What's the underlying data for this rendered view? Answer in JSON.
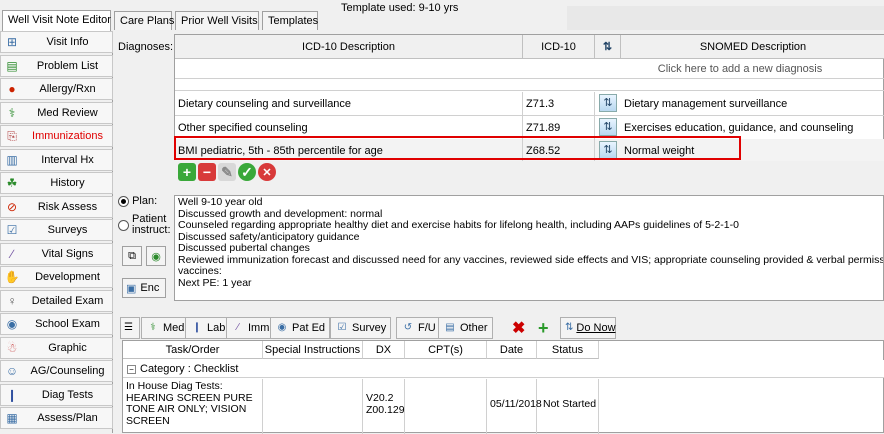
{
  "tabs": [
    "Well Visit Note Editor",
    "Care Plans",
    "Prior Well Visits",
    "Templates"
  ],
  "template_used": "Template used: 9-10 yrs",
  "sidebar": [
    {
      "label": "Visit Info",
      "icon": "visit-info-icon",
      "glyph": "⊞",
      "color": "#3a6ea5"
    },
    {
      "label": "Problem List",
      "icon": "problem-list-icon",
      "glyph": "▤",
      "color": "#2a8a2a"
    },
    {
      "label": "Allergy/Rxn",
      "icon": "allergy-icon",
      "glyph": "●",
      "color": "#cc2200"
    },
    {
      "label": "Med Review",
      "icon": "med-review-icon",
      "glyph": "⚕",
      "color": "#2a8a2a"
    },
    {
      "label": "Immunizations",
      "icon": "immunizations-icon",
      "glyph": "⎘",
      "color": "#b04040"
    },
    {
      "label": "Interval Hx",
      "icon": "interval-hx-icon",
      "glyph": "▥",
      "color": "#3a6ea5"
    },
    {
      "label": "History",
      "icon": "history-icon",
      "glyph": "☘",
      "color": "#2a8a2a"
    },
    {
      "label": "Risk Assess",
      "icon": "risk-assess-icon",
      "glyph": "⊘",
      "color": "#cc2200"
    },
    {
      "label": "Surveys",
      "icon": "surveys-icon",
      "glyph": "☑",
      "color": "#3a6ea5"
    },
    {
      "label": "Vital Signs",
      "icon": "vital-signs-icon",
      "glyph": "∕",
      "color": "#7050a0"
    },
    {
      "label": "Development",
      "icon": "development-icon",
      "glyph": "✋",
      "color": "#c08030"
    },
    {
      "label": "Detailed Exam",
      "icon": "detailed-exam-icon",
      "glyph": "♀",
      "color": "#555555"
    },
    {
      "label": "School Exam",
      "icon": "school-exam-icon",
      "glyph": "◉",
      "color": "#3a6ea5"
    },
    {
      "label": "Graphic",
      "icon": "graphic-icon",
      "glyph": "☃",
      "color": "#cc5050"
    },
    {
      "label": "AG/Counseling",
      "icon": "ag-counseling-icon",
      "glyph": "☺",
      "color": "#3a6ea5"
    },
    {
      "label": "Diag Tests",
      "icon": "diag-tests-icon",
      "glyph": "❙",
      "color": "#3050a0"
    },
    {
      "label": "Assess/Plan",
      "icon": "assess-plan-icon",
      "glyph": "▦",
      "color": "#3a6ea5"
    }
  ],
  "diagnoses": {
    "label": "Diagnoses:",
    "headers": {
      "desc": "ICD-10 Description",
      "code": "ICD-10",
      "snomed": "SNOMED Description"
    },
    "add_prompt": "Click here to add a new diagnosis",
    "rows": [
      {
        "desc": "Dietary counseling and surveillance",
        "code": "Z71.3",
        "snomed": "Dietary management surveillance"
      },
      {
        "desc": "Other specified counseling",
        "code": "Z71.89",
        "snomed": "Exercises education, guidance, and counseling"
      },
      {
        "desc": "BMI pediatric, 5th - 85th percentile for age",
        "code": "Z68.52",
        "snomed": "Normal weight"
      }
    ]
  },
  "plan": {
    "plan_label": "Plan:",
    "patient_label": "Patient",
    "instruct_label": "instruct:",
    "enc_label": "Enc",
    "lines": [
      "Well 9-10 year old",
      "Discussed growth and development: normal",
      "Counseled regarding appropriate healthy diet and exercise habits for lifelong health, including AAPs guidelines of 5-2-1-0",
      "Discussed safety/anticipatory guidance",
      "Discussed pubertal changes",
      "Reviewed immunization forecast and discussed need for any vaccines, reviewed side effects and VIS;  appropriate counseling provided & verbal permiss",
      "vaccines:",
      "Next PE: 1 year"
    ]
  },
  "orders_toolbar": {
    "med": "Med",
    "lab": "Lab",
    "imm": "Imm",
    "pat_ed": "Pat Ed",
    "survey": "Survey",
    "fu": "F/U",
    "other": "Other",
    "do_now": "Do Now"
  },
  "orders": {
    "headers": [
      "Task/Order",
      "Special Instructions",
      "DX",
      "CPT(s)",
      "Date",
      "Status"
    ],
    "category": "Category : Checklist",
    "row": {
      "task": "In House Diag Tests:\nHEARING SCREEN PURE\nTONE AIR ONLY; VISION\nSCREEN",
      "special": "",
      "dx": "V20.2\nZ00.129",
      "cpt": "",
      "date": "05/11/2018",
      "status": "Not Started"
    }
  }
}
